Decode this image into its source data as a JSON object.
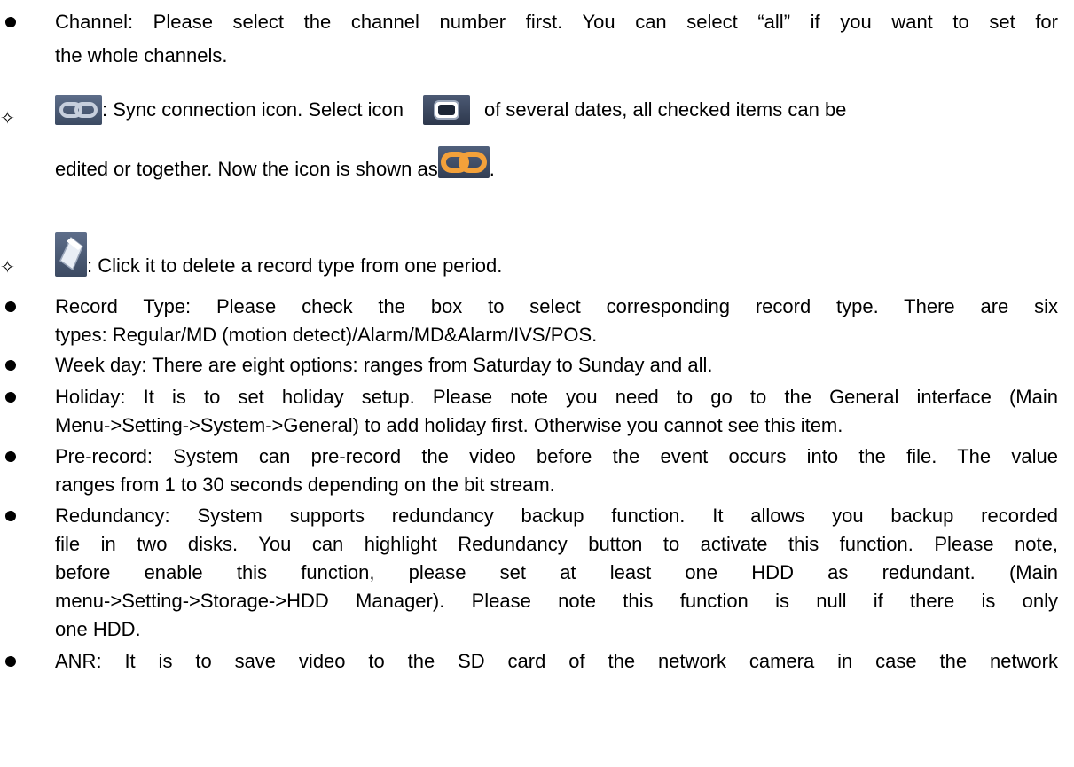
{
  "colors": {
    "text": "#000000",
    "icon_panel": "#4a5872",
    "sync_active": "#f3a13a"
  },
  "items": {
    "channel": "Channel: Please select the channel number first. You can select “all” if you want to set for",
    "channel_cont": "the whole channels.",
    "sync_text1": ": Sync connection icon. Select icon",
    "sync_text2": "of several dates, all checked items can be",
    "sync_text3": "edited or together. Now the icon is shown as",
    "sync_text4": ".",
    "delete_text": ": Click it to delete a record type from one period.",
    "record_type1": "Record Type: Please check the box to select corresponding record type. There are six",
    "record_type2": "types: Regular/MD (motion detect)/Alarm/MD&Alarm/IVS/POS.",
    "week_day": "Week day: There are eight options: ranges from Saturday to Sunday and all.",
    "holiday1": "Holiday: It is to set holiday setup. Please note you need to go to the General interface (Main",
    "holiday2": "Menu->Setting->System->General) to add holiday first. Otherwise you cannot see this item.",
    "prerecord1": "Pre-record: System can pre-record the video before the event occurs into the file. The value",
    "prerecord2": "ranges from 1 to 30 seconds depending on the bit stream.",
    "redundancy1": "Redundancy: System supports redundancy backup function. It allows you backup recorded",
    "redundancy2": "file in two disks. You can highlight Redundancy button to activate this function. Please note,",
    "redundancy3": "before enable this function, please set at least one HDD as redundant. (Main",
    "redundancy4": "menu->Setting->Storage->HDD Manager). Please note this function is null if there is only",
    "redundancy5": "one HDD.",
    "anr1": "ANR: It is to save video to the SD card of the network camera in case the network"
  },
  "icons": {
    "bullet": "bullet-dot",
    "diamond": "✧",
    "sync_gray": "sync-connection-icon",
    "square": "select-square-icon",
    "sync_orange": "sync-connection-active-icon",
    "eraser": "eraser-icon"
  }
}
